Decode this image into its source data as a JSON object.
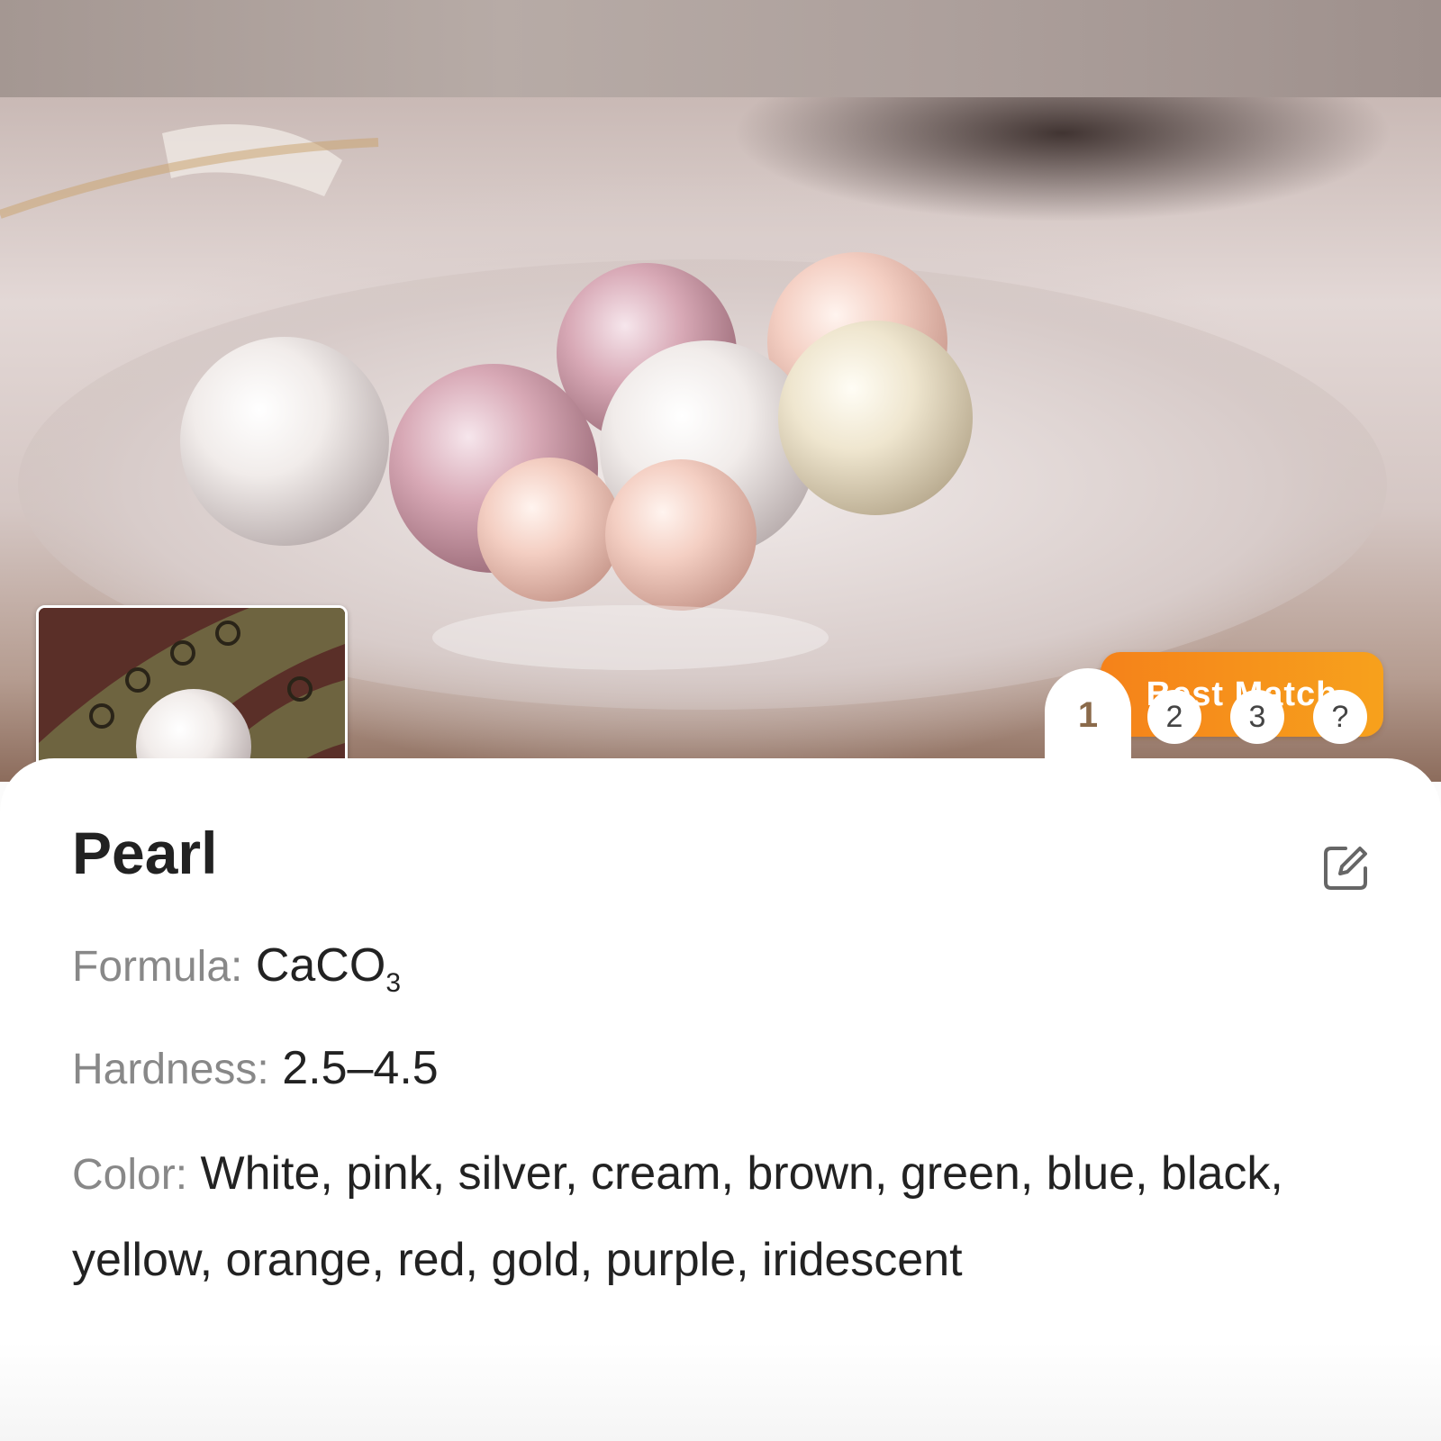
{
  "hero": {
    "badge_label": "Best Match",
    "result_tabs": [
      "1",
      "2",
      "3",
      "?"
    ],
    "active_tab": "1"
  },
  "details": {
    "title": "Pearl",
    "formula_label": "Formula:",
    "formula_main": "CaCO",
    "formula_subscript": "3",
    "hardness_label": "Hardness:",
    "hardness_value": "2.5–4.5",
    "color_label": "Color:",
    "color_value": "White, pink, silver, cream, brown, green, blue, black, yellow, orange, red, gold, purple, iridescent"
  },
  "icons": {
    "edit": "edit-icon",
    "photo": "user-photo-thumbnail"
  },
  "colors": {
    "badge_start": "#f5821a",
    "badge_end": "#f7a11c",
    "label_gray": "#888888",
    "text_dark": "#222222"
  }
}
